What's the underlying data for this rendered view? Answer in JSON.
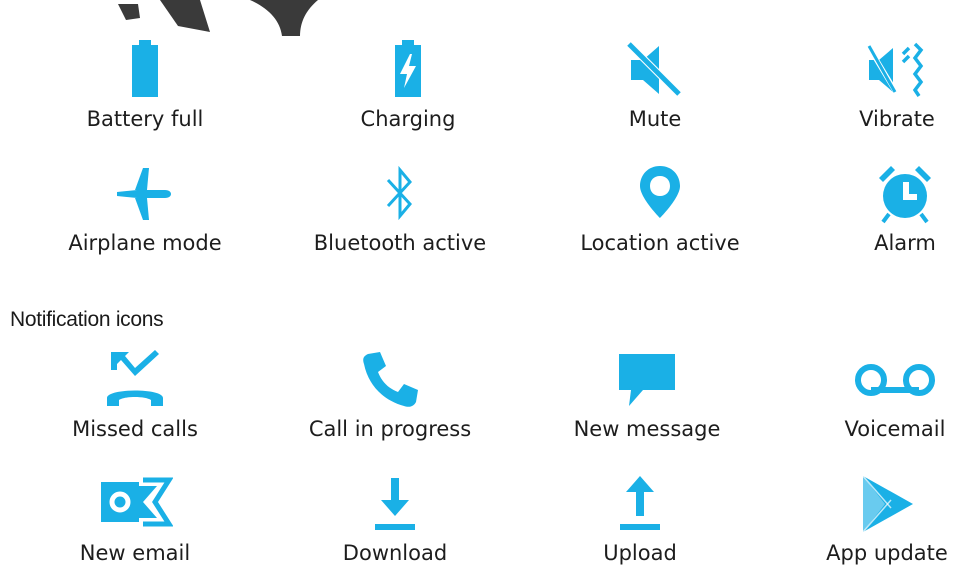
{
  "colors": {
    "accent": "#1ab0e6",
    "text": "#1d1d1d"
  },
  "status_icons": [
    {
      "label": "Battery full",
      "icon": "battery-full-icon"
    },
    {
      "label": "Charging",
      "icon": "battery-charging-icon"
    },
    {
      "label": "Mute",
      "icon": "mute-icon"
    },
    {
      "label": "Vibrate",
      "icon": "vibrate-icon"
    },
    {
      "label": "Airplane mode",
      "icon": "airplane-icon"
    },
    {
      "label": "Bluetooth active",
      "icon": "bluetooth-icon"
    },
    {
      "label": "Location active",
      "icon": "location-pin-icon"
    },
    {
      "label": "Alarm",
      "icon": "alarm-clock-icon"
    }
  ],
  "notification_section": {
    "title": "Notification icons"
  },
  "notification_icons": [
    {
      "label": "Missed calls",
      "icon": "missed-call-icon"
    },
    {
      "label": "Call in progress",
      "icon": "phone-call-icon"
    },
    {
      "label": "New message",
      "icon": "message-bubble-icon"
    },
    {
      "label": "Voicemail",
      "icon": "voicemail-icon"
    },
    {
      "label": "New email",
      "icon": "email-icon"
    },
    {
      "label": "Download",
      "icon": "download-icon"
    },
    {
      "label": "Upload",
      "icon": "upload-icon"
    },
    {
      "label": "App update",
      "icon": "play-store-icon"
    }
  ]
}
